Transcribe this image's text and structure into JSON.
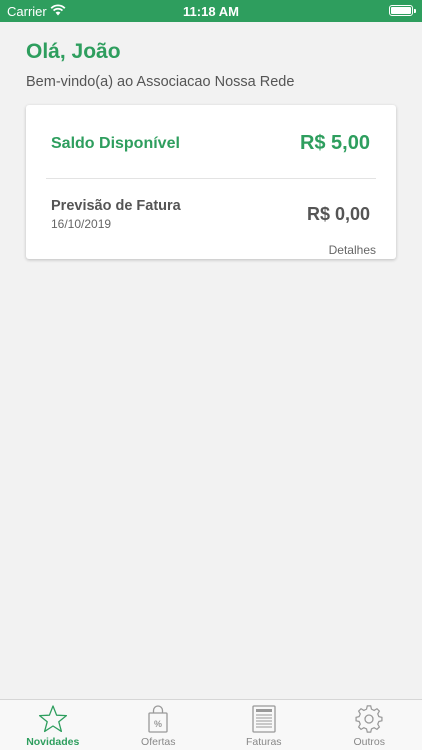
{
  "status_bar": {
    "carrier": "Carrier",
    "time": "11:18 AM"
  },
  "header": {
    "greeting": "Olá, João",
    "welcome": "Bem-vindo(a) ao Associacao Nossa Rede"
  },
  "card": {
    "saldo_label": "Saldo Disponível",
    "saldo_value": "R$ 5,00",
    "previsao_label": "Previsão de Fatura",
    "previsao_date": "16/10/2019",
    "previsao_value": "R$ 0,00",
    "detalhes_label": "Detalhes"
  },
  "tabbar": {
    "items": [
      {
        "label": "Novidades",
        "icon": "star-icon",
        "active": true
      },
      {
        "label": "Ofertas",
        "icon": "shopping-bag-icon",
        "active": false
      },
      {
        "label": "Faturas",
        "icon": "invoice-icon",
        "active": false
      },
      {
        "label": "Outros",
        "icon": "gear-icon",
        "active": false
      }
    ]
  },
  "colors": {
    "accent": "#2e9e5e",
    "background": "#f2f2f2",
    "text_secondary": "#555555"
  }
}
